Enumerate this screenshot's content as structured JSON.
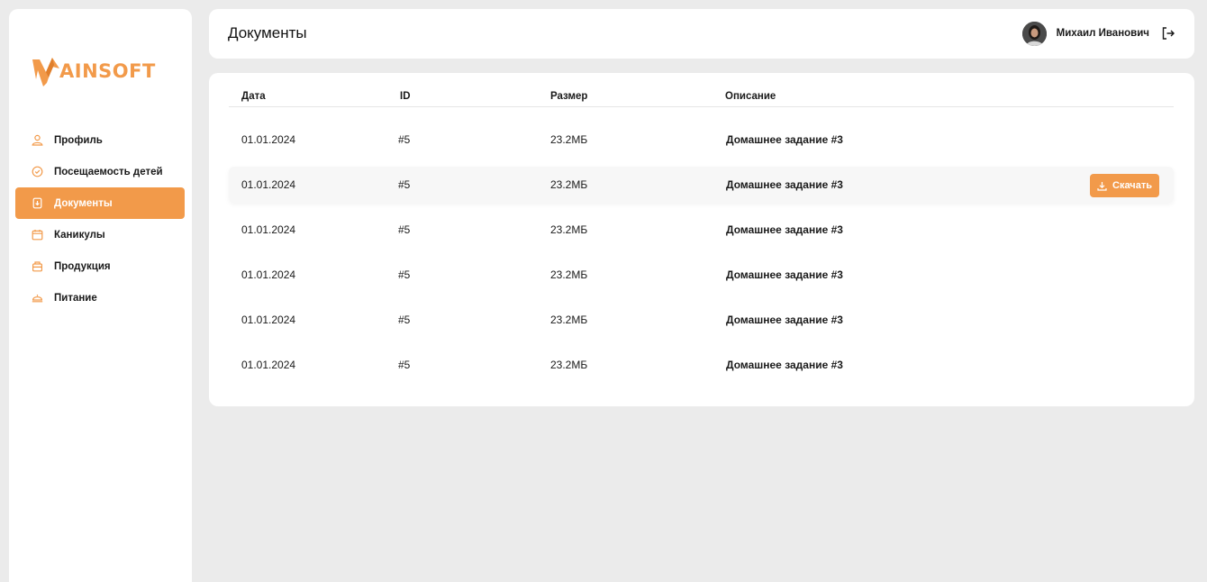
{
  "brand": {
    "logo_text": "AINSOFT",
    "accent": "#f29a4a"
  },
  "sidebar": {
    "items": [
      {
        "label": "Профиль",
        "icon": "user-icon",
        "active": false
      },
      {
        "label": "Посещаемость детей",
        "icon": "check-circle-icon",
        "active": false
      },
      {
        "label": "Документы",
        "icon": "document-icon",
        "active": true
      },
      {
        "label": "Каникулы",
        "icon": "calendar-icon",
        "active": false
      },
      {
        "label": "Продукция",
        "icon": "box-icon",
        "active": false
      },
      {
        "label": "Питание",
        "icon": "food-dish-icon",
        "active": false
      }
    ]
  },
  "header": {
    "title": "Документы",
    "user_name": "Михаил Иванович"
  },
  "table": {
    "columns": [
      "Дата",
      "ID",
      "Размер",
      "Описание"
    ],
    "rows": [
      {
        "date": "01.01.2024",
        "id": "#5",
        "size": "23.2МБ",
        "description": "Домашнее задание #3"
      },
      {
        "date": "01.01.2024",
        "id": "#5",
        "size": "23.2МБ",
        "description": "Домашнее задание #3"
      },
      {
        "date": "01.01.2024",
        "id": "#5",
        "size": "23.2МБ",
        "description": "Домашнее задание #3"
      },
      {
        "date": "01.01.2024",
        "id": "#5",
        "size": "23.2МБ",
        "description": "Домашнее задание #3"
      },
      {
        "date": "01.01.2024",
        "id": "#5",
        "size": "23.2МБ",
        "description": "Домашнее задание #3"
      },
      {
        "date": "01.01.2024",
        "id": "#5",
        "size": "23.2МБ",
        "description": "Домашнее задание #3"
      }
    ],
    "download_label": "Скачать"
  }
}
